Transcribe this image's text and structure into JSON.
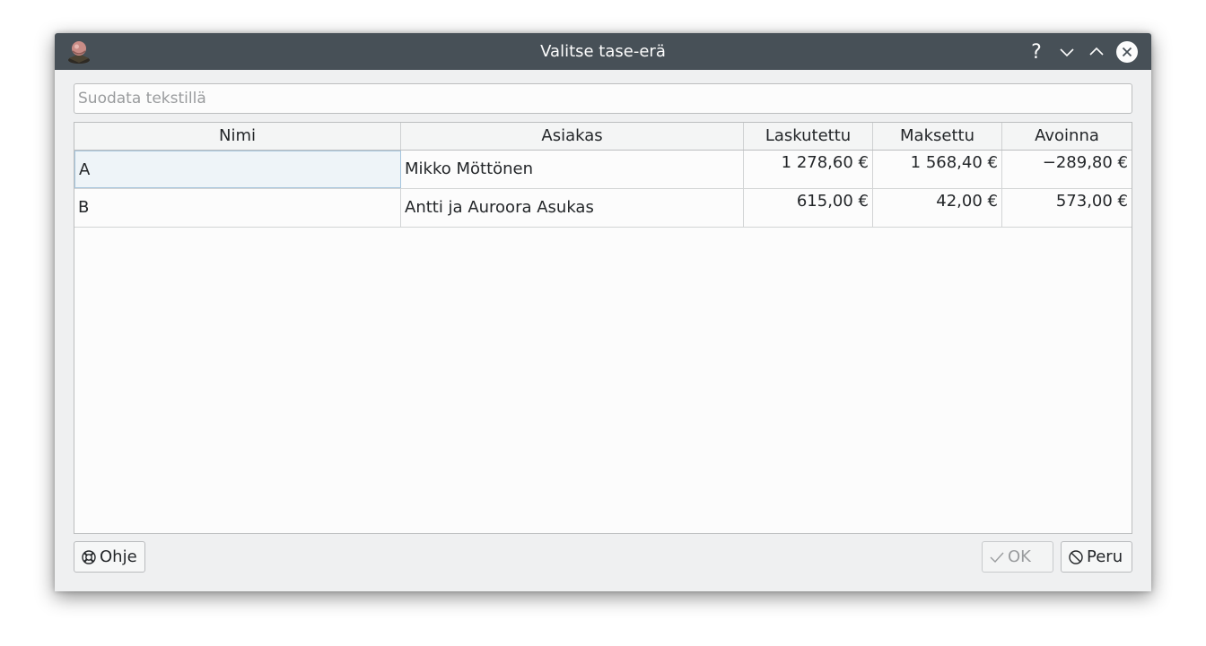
{
  "window": {
    "title": "Valitse tase-erä",
    "controls": {
      "help": "?",
      "minimize": "chevron-down-icon",
      "maximize": "chevron-up-icon",
      "close": "close-icon"
    }
  },
  "filter": {
    "placeholder": "Suodata tekstillä",
    "value": ""
  },
  "table": {
    "columns": [
      "Nimi",
      "Asiakas",
      "Laskutettu",
      "Maksettu",
      "Avoinna"
    ],
    "rows": [
      {
        "nimi": "A",
        "asiakas": "Mikko Möttönen",
        "laskutettu": "1 278,60 €",
        "maksettu": "1 568,40 €",
        "avoinna": "−289,80 €"
      },
      {
        "nimi": "B",
        "asiakas": "Antti ja Auroora Asukas",
        "laskutettu": "615,00 €",
        "maksettu": "42,00 €",
        "avoinna": "573,00 €"
      }
    ]
  },
  "buttons": {
    "help": "Ohje",
    "ok": "OK",
    "cancel": "Peru"
  },
  "colors": {
    "titlebar": "#475057",
    "background": "#eff0f1",
    "selection": "#eef4f8"
  }
}
